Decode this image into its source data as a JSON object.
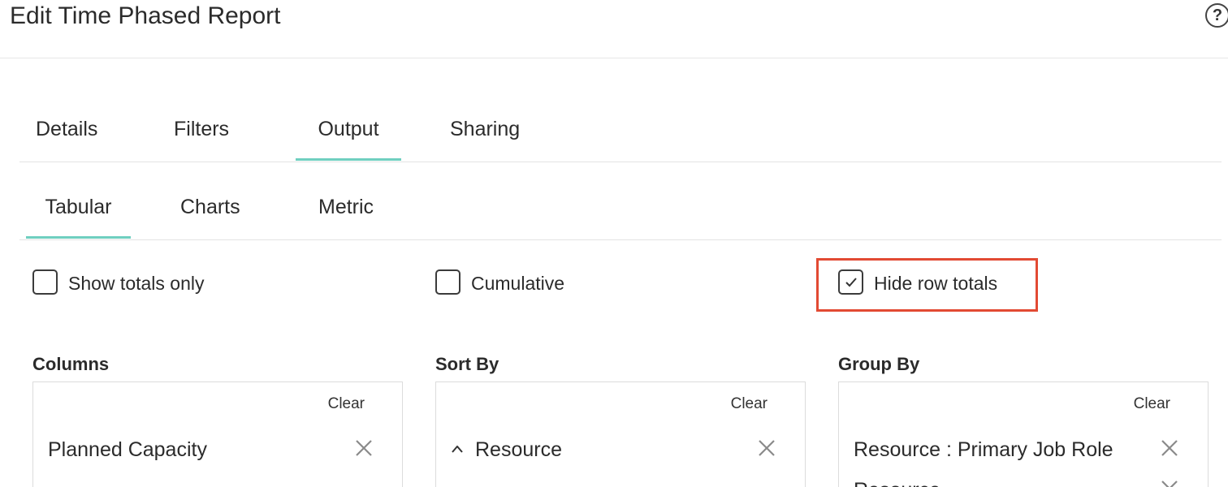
{
  "header": {
    "title": "Edit Time Phased Report",
    "help_icon": "help-circle-icon",
    "help_glyph": "?"
  },
  "tabs": [
    {
      "label": "Details",
      "active": false
    },
    {
      "label": "Filters",
      "active": false
    },
    {
      "label": "Output",
      "active": true
    },
    {
      "label": "Sharing",
      "active": false
    }
  ],
  "subtabs": [
    {
      "label": "Tabular",
      "active": true
    },
    {
      "label": "Charts",
      "active": false
    },
    {
      "label": "Metric",
      "active": false
    }
  ],
  "options": [
    {
      "label": "Show totals only",
      "checked": false
    },
    {
      "label": "Cumulative",
      "checked": false
    },
    {
      "label": "Hide row totals",
      "checked": true
    }
  ],
  "colors": {
    "accent": "#6fcfc0",
    "highlight": "#e24a33"
  },
  "columns": {
    "label": "Columns",
    "clear_label": "Clear",
    "items": [
      {
        "label": "Planned Capacity"
      }
    ]
  },
  "sort_by": {
    "label": "Sort By",
    "clear_label": "Clear",
    "items": [
      {
        "label": "Resource",
        "direction": "ascending"
      }
    ]
  },
  "group_by": {
    "label": "Group By",
    "clear_label": "Clear",
    "items": [
      {
        "label": "Resource : Primary Job Role"
      },
      {
        "label": "Resource"
      }
    ]
  }
}
